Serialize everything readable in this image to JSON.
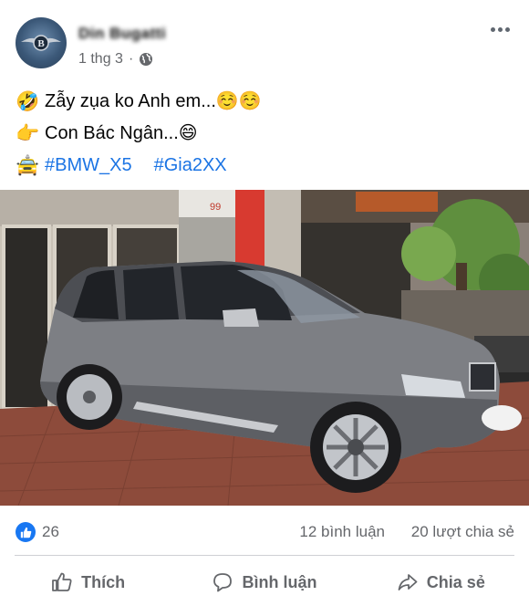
{
  "post": {
    "author": "Din Bugatti",
    "timestamp": "1 thg 3",
    "separator": "·",
    "privacy_icon": "globe-icon",
    "more_icon": "more-options-icon",
    "lines": [
      {
        "emoji": "🤣",
        "emoji_name": "rolling-laughing-emoji",
        "text": "Zẫy zụa ko Anh em...☺️☺️"
      },
      {
        "emoji": "👉",
        "emoji_name": "pointing-right-emoji",
        "text": "Con Bác Ngân...😄"
      },
      {
        "emoji": "🚖",
        "emoji_name": "taxi-emoji",
        "hashtags": [
          "#BMW_X5",
          "#Gia2XX"
        ]
      }
    ],
    "photo": {
      "description_icon": "car-photo",
      "sign_text": "99"
    }
  },
  "stats": {
    "likes": "26",
    "comments": "12 bình luận",
    "shares": "20 lượt chia sẻ"
  },
  "actions": {
    "like": "Thích",
    "comment": "Bình luận",
    "share": "Chia sẻ"
  },
  "colors": {
    "link": "#1b74e4",
    "like_blue": "#1877f2",
    "secondary_text": "#65676b"
  }
}
